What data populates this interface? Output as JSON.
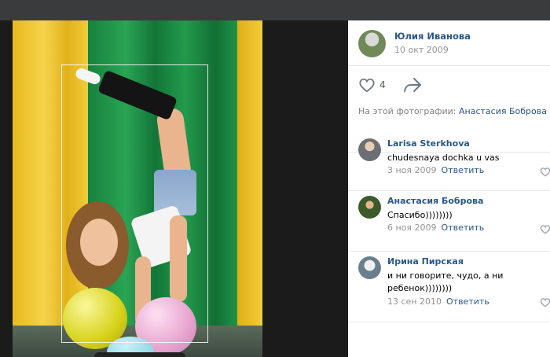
{
  "photo_panel": {
    "author": {
      "name": "Юлия Иванова",
      "date": "10 окт 2009"
    },
    "likes": {
      "count": "4"
    },
    "tagged": {
      "prefix": "На этой фотографии:",
      "person": "Анастасия Боброва"
    }
  },
  "comments": [
    {
      "author": "Larisa Sterkhova",
      "text": "chudesnaya dochka u vas",
      "date": "3 ноя 2009",
      "reply": "Ответить"
    },
    {
      "author": "Анастасия Боброва",
      "text": "Спасибо))))))))",
      "date": "6 ноя 2009",
      "reply": "Ответить"
    },
    {
      "author": "Ирина Пирская",
      "text": "и ни говорите, чудо, а ни ребенок))))))))",
      "date": "13 сен 2010",
      "reply": "Ответить"
    }
  ],
  "colors": {
    "link": "#2a5885",
    "muted": "#939393",
    "divider": "#e7e8ec"
  },
  "icons": [
    "heart-icon",
    "share-arrow-icon",
    "comment-like-heart-icon"
  ]
}
